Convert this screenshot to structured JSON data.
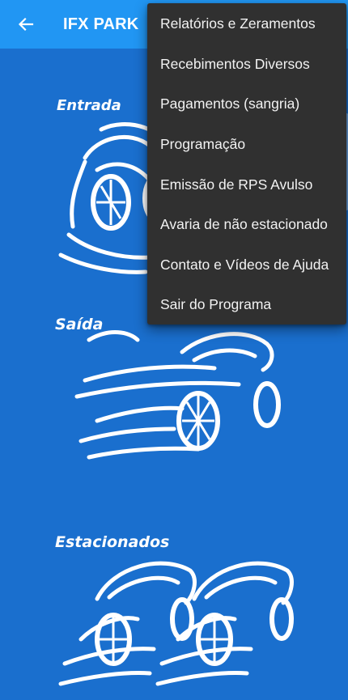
{
  "app_bar": {
    "title": "IFX PARK",
    "back_icon": "arrow-left-icon",
    "background": "#2196f3"
  },
  "tiles": [
    {
      "label": "Entrada",
      "icon": "car-front-icon"
    },
    {
      "label": "Saída",
      "icon": "car-side-speed-icon"
    },
    {
      "label": "Estacionados",
      "icon": "two-cars-parked-icon"
    }
  ],
  "menu": {
    "items": [
      "Relatórios e Zeramentos",
      "Recebimentos Diversos",
      "Pagamentos (sangria)",
      "Programação",
      "Emissão de RPS Avulso",
      "Avaria de não estacionado",
      "Contato e Vídeos de Ajuda",
      "Sair do Programa"
    ],
    "background": "#303030"
  },
  "colors": {
    "content_background": "#1a6fce",
    "text_on_primary": "#ffffff"
  }
}
